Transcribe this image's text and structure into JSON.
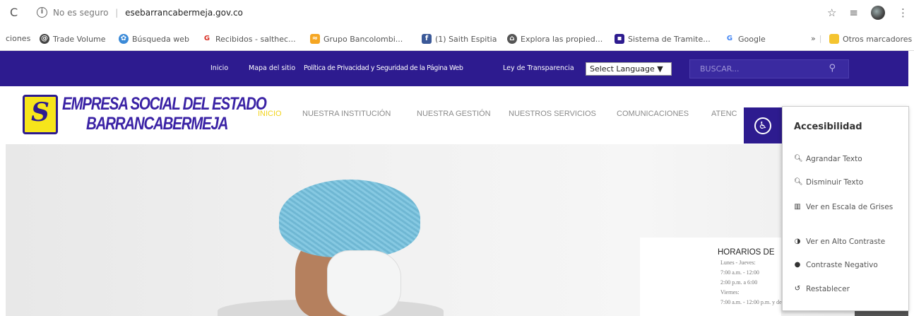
{
  "browser": {
    "security_label": "No es seguro",
    "url": "esebarrancabermeja.gov.co"
  },
  "bookmarks": [
    {
      "label": "ciones",
      "icon": "truncated",
      "color": "#ffffff"
    },
    {
      "label": "Trade Volume",
      "icon": "trade-volume-icon",
      "color": "#444444"
    },
    {
      "label": "Búsqueda web",
      "icon": "web-search-icon",
      "color": "#3b8ad8"
    },
    {
      "label": "Recibidos - salthec...",
      "icon": "gmail-icon",
      "color": "#d93025"
    },
    {
      "label": "Grupo Bancolombi...",
      "icon": "bancolombia-icon",
      "color": "#f5a623"
    },
    {
      "label": "(1) Saith Espitia",
      "icon": "facebook-icon",
      "color": "#3b5998"
    },
    {
      "label": "Explora las propied...",
      "icon": "property-icon",
      "color": "#555555"
    },
    {
      "label": "Sistema de Tramite...",
      "icon": "system-icon",
      "color": "#2d1b8f"
    },
    {
      "label": "Google",
      "icon": "google-icon",
      "color": "#4285f4"
    },
    {
      "label": "»",
      "icon": "more-icon",
      "color": "#555555"
    },
    {
      "label": "Otros marcadores",
      "icon": "folder-icon",
      "color": "#f4c430"
    }
  ],
  "topbar": {
    "links": [
      "Inicio",
      "Mapa del sitio",
      "Política de Privacidad y Seguridad de la Página Web",
      "Ley de Transparencia"
    ],
    "language_select": "Select Language ▼",
    "search_placeholder": "BUSCAR..."
  },
  "header": {
    "logo_line1": "EMPRESA SOCIAL DEL ESTADO",
    "logo_line2": "BARRANCABERMEJA",
    "logo_letter": "S",
    "nav": [
      "INICIO",
      "NUESTRA INSTITUCIÓN",
      "NUESTRA GESTIÓN",
      "NUESTROS SERVICIOS",
      "COMUNICACIONES",
      "ATENC"
    ],
    "active_nav": "INICIO"
  },
  "hours": {
    "title": "HORARIOS DE",
    "lines": [
      "Lunes - Jueves:",
      "7:00 a.m. - 12:00",
      "2:00 p.m. a 6:00",
      "Viernes:",
      "7:00 a.m. - 12:00 p.m. y de"
    ]
  },
  "accessibility": {
    "title": "Accesibilidad",
    "items": [
      {
        "label": "Agrandar Texto",
        "icon": "zoom-in-icon"
      },
      {
        "label": "Disminuir Texto",
        "icon": "zoom-out-icon"
      },
      {
        "label": "Ver en Escala de Grises",
        "icon": "grayscale-icon"
      },
      {
        "label": "Ver en Alto Contraste",
        "icon": "contrast-icon"
      },
      {
        "label": "Contraste Negativo",
        "icon": "eye-icon"
      },
      {
        "label": "Restablecer",
        "icon": "reset-icon"
      }
    ]
  },
  "colors": {
    "brand_purple": "#2d1b8f",
    "brand_yellow": "#f6e51b",
    "active_nav": "#f2d31a"
  }
}
